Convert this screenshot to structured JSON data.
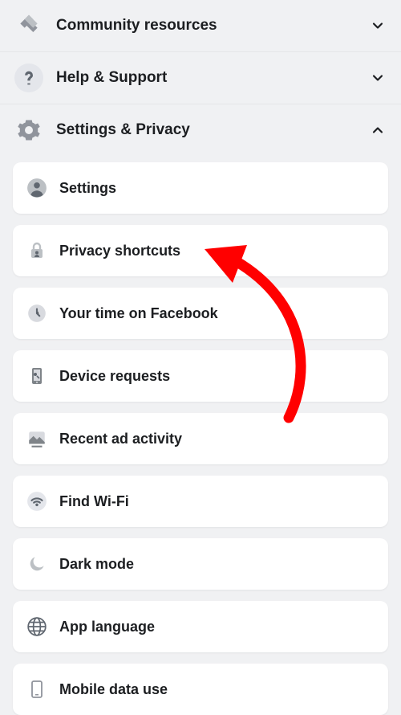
{
  "headers": {
    "community": {
      "label": "Community resources"
    },
    "help": {
      "label": "Help & Support"
    },
    "settings": {
      "label": "Settings & Privacy"
    }
  },
  "cards": {
    "settings": {
      "label": "Settings"
    },
    "privacy": {
      "label": "Privacy shortcuts"
    },
    "yourtime": {
      "label": "Your time on Facebook"
    },
    "device": {
      "label": "Device requests"
    },
    "adactivity": {
      "label": "Recent ad activity"
    },
    "wifi": {
      "label": "Find Wi-Fi"
    },
    "darkmode": {
      "label": "Dark mode"
    },
    "applang": {
      "label": "App language"
    },
    "mobiledata": {
      "label": "Mobile data use"
    }
  }
}
